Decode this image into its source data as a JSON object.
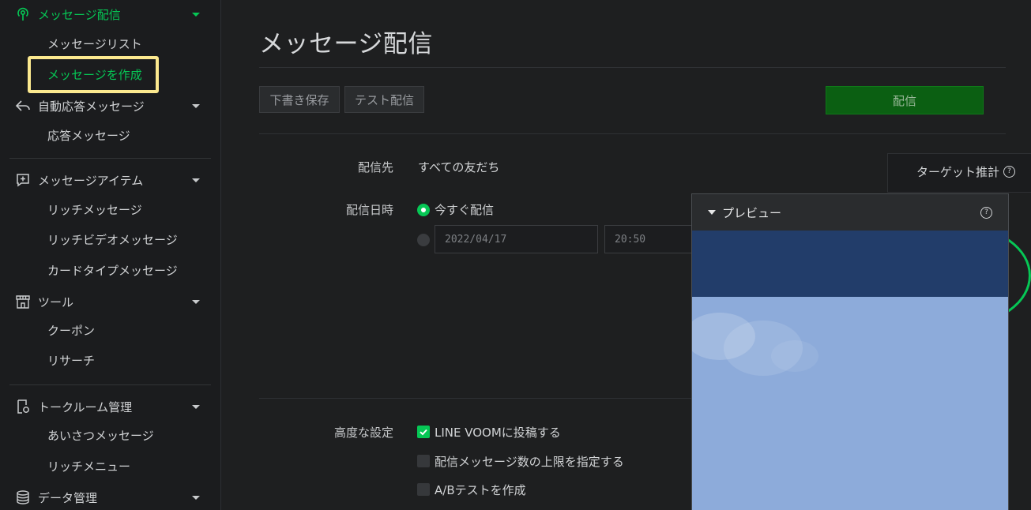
{
  "sidebar": {
    "sections": [
      {
        "label": "メッセージ配信",
        "icon": "broadcast-icon",
        "active": true,
        "items": [
          {
            "label": "メッセージリスト"
          },
          {
            "label": "メッセージを作成",
            "active": true
          }
        ]
      },
      {
        "label": "自動応答メッセージ",
        "icon": "reply-icon",
        "items": [
          {
            "label": "応答メッセージ"
          }
        ]
      },
      {
        "label": "メッセージアイテム",
        "icon": "add-message-icon",
        "items": [
          {
            "label": "リッチメッセージ"
          },
          {
            "label": "リッチビデオメッセージ"
          },
          {
            "label": "カードタイプメッセージ"
          }
        ]
      },
      {
        "label": "ツール",
        "icon": "store-icon",
        "items": [
          {
            "label": "クーポン"
          },
          {
            "label": "リサーチ"
          }
        ]
      },
      {
        "label": "トークルーム管理",
        "icon": "chat-settings-icon",
        "items": [
          {
            "label": "あいさつメッセージ"
          },
          {
            "label": "リッチメニュー"
          }
        ]
      },
      {
        "label": "データ管理",
        "icon": "database-icon",
        "items": []
      }
    ]
  },
  "main": {
    "title": "メッセージ配信",
    "toolbar": {
      "draft_label": "下書き保存",
      "test_label": "テスト配信",
      "send_label": "配信"
    },
    "recipients": {
      "label": "配信先",
      "value": "すべての友だち"
    },
    "schedule": {
      "label": "配信日時",
      "now_label": "今すぐ配信",
      "date_value": "2022/04/17",
      "time_value": "20:50"
    },
    "advanced": {
      "label": "高度な設定",
      "options": [
        {
          "label": "LINE VOOMに投稿する",
          "checked": true
        },
        {
          "label": "配信メッセージ数の上限を指定する",
          "checked": false
        },
        {
          "label": "A/Bテストを作成",
          "checked": false
        }
      ]
    },
    "target": {
      "label": "ターゲット推計"
    },
    "preview": {
      "label": "プレビュー"
    }
  },
  "colors": {
    "accent": "#06c755",
    "highlight": "#fce98f",
    "send_button": "#0b5f12"
  }
}
